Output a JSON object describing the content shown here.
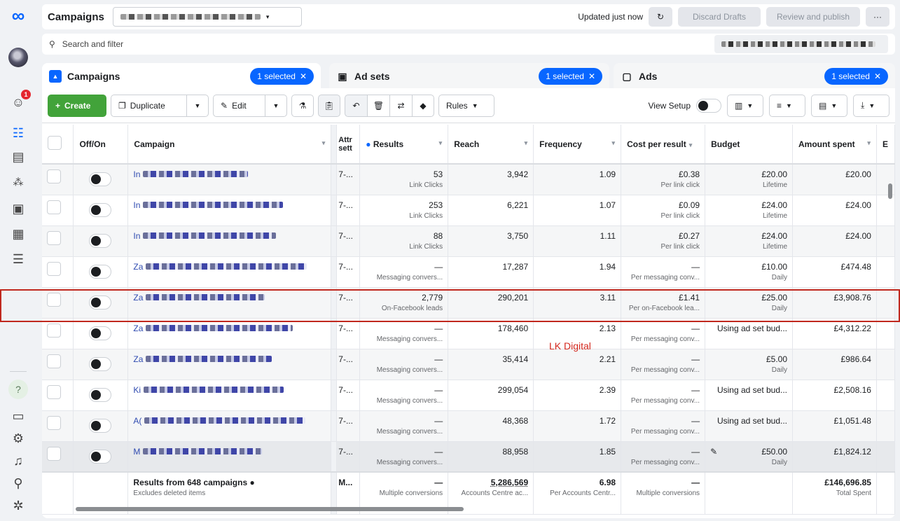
{
  "nav_rail": {
    "badge_count": "1"
  },
  "topbar": {
    "title": "Campaigns",
    "status": "Updated just now",
    "discard_label": "Discard Drafts",
    "review_label": "Review and publish",
    "more_label": "···"
  },
  "search": {
    "placeholder": "Search and filter"
  },
  "tabs": [
    {
      "label": "Campaigns",
      "selected": "1 selected"
    },
    {
      "label": "Ad sets",
      "selected": "1 selected"
    },
    {
      "label": "Ads",
      "selected": "1 selected"
    }
  ],
  "toolbar": {
    "create": "Create",
    "duplicate": "Duplicate",
    "edit": "Edit",
    "rules": "Rules",
    "view_setup": "View Setup"
  },
  "columns": {
    "onoff": "Off/On",
    "campaign": "Campaign",
    "attr": "Attr sett",
    "results": "Results",
    "reach": "Reach",
    "frequency": "Frequency",
    "cpr": "Cost per result",
    "budget": "Budget",
    "spent": "Amount spent"
  },
  "rows": [
    {
      "pre": "In",
      "attr": "7-...",
      "results": "53",
      "results_sub": "Link Clicks",
      "reach": "3,942",
      "freq": "1.09",
      "cpr": "£0.38",
      "cpr_sub": "Per link click",
      "budget": "£20.00",
      "budget_sub": "Lifetime",
      "spent": "£20.00"
    },
    {
      "pre": "In",
      "attr": "7-...",
      "results": "253",
      "results_sub": "Link Clicks",
      "reach": "6,221",
      "freq": "1.07",
      "cpr": "£0.09",
      "cpr_sub": "Per link click",
      "budget": "£24.00",
      "budget_sub": "Lifetime",
      "spent": "£24.00"
    },
    {
      "pre": "In",
      "attr": "7-...",
      "results": "88",
      "results_sub": "Link Clicks",
      "reach": "3,750",
      "freq": "1.11",
      "cpr": "£0.27",
      "cpr_sub": "Per link click",
      "budget": "£24.00",
      "budget_sub": "Lifetime",
      "spent": "£24.00"
    },
    {
      "pre": "Za",
      "attr": "7-...",
      "results": "—",
      "results_sub": "Messaging convers...",
      "reach": "17,287",
      "freq": "1.94",
      "cpr": "—",
      "cpr_sub": "Per messaging conv...",
      "budget": "£10.00",
      "budget_sub": "Daily",
      "spent": "£474.48"
    },
    {
      "pre": "Za",
      "attr": "7-...",
      "results": "2,779",
      "results_sub": "On-Facebook leads",
      "reach": "290,201",
      "freq": "3.11",
      "cpr": "£1.41",
      "cpr_sub": "Per on-Facebook lea...",
      "budget": "£25.00",
      "budget_sub": "Daily",
      "spent": "£3,908.76"
    },
    {
      "pre": "Za",
      "attr": "7-...",
      "results": "—",
      "results_sub": "Messaging convers...",
      "reach": "178,460",
      "freq": "2.13",
      "cpr": "—",
      "cpr_sub": "Per messaging conv...",
      "budget": "Using ad set bud...",
      "budget_sub": "",
      "spent": "£4,312.22"
    },
    {
      "pre": "Za",
      "attr": "7-...",
      "results": "—",
      "results_sub": "Messaging convers...",
      "reach": "35,414",
      "freq": "2.21",
      "cpr": "—",
      "cpr_sub": "Per messaging conv...",
      "budget": "£5.00",
      "budget_sub": "Daily",
      "spent": "£986.64"
    },
    {
      "pre": "Ki",
      "attr": "7-...",
      "results": "—",
      "results_sub": "Messaging convers...",
      "reach": "299,054",
      "freq": "2.39",
      "cpr": "—",
      "cpr_sub": "Per messaging conv...",
      "budget": "Using ad set bud...",
      "budget_sub": "",
      "spent": "£2,508.16"
    },
    {
      "pre": "A(",
      "attr": "7-...",
      "results": "—",
      "results_sub": "Messaging convers...",
      "reach": "48,368",
      "freq": "1.72",
      "cpr": "—",
      "cpr_sub": "Per messaging conv...",
      "budget": "Using ad set bud...",
      "budget_sub": "",
      "spent": "£1,051.48"
    },
    {
      "pre": "M",
      "attr": "7-...",
      "results": "—",
      "results_sub": "Messaging convers...",
      "reach": "88,958",
      "freq": "1.85",
      "cpr": "—",
      "cpr_sub": "Per messaging conv...",
      "budget": "£50.00",
      "budget_sub": "Daily",
      "spent": "£1,824.12"
    }
  ],
  "footer": {
    "campaign": "Results from 648 campaigns",
    "campaign_sub": "Excludes deleted items",
    "attr": "M...",
    "results": "—",
    "results_sub": "Multiple conversions",
    "reach": "5,286,569",
    "reach_sub": "Accounts Centre ac...",
    "freq": "6.98",
    "freq_sub": "Per Accounts Centr...",
    "cpr": "—",
    "cpr_sub": "Multiple conversions",
    "spent": "£146,696.85",
    "spent_sub": "Total Spent"
  },
  "watermark": "LK Digital",
  "colors": {
    "accent": "#0866ff",
    "create": "#42a33a",
    "highlight": "#c0281e"
  }
}
